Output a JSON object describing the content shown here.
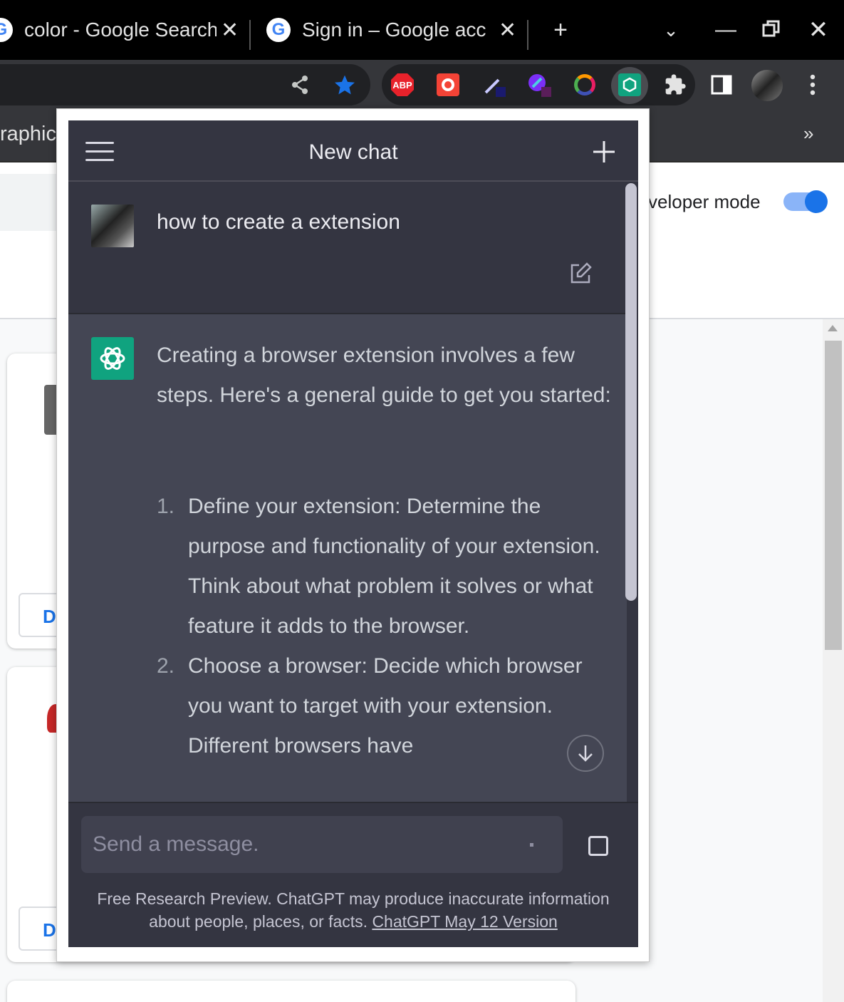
{
  "tabs": [
    {
      "title": "color - Google Search",
      "favicon": "google-icon"
    },
    {
      "title": "Sign in – Google accounts",
      "favicon": "google-icon"
    }
  ],
  "bookmarks": {
    "partial_text": "raphic",
    "overflow": "»"
  },
  "extensions": [
    "share-icon",
    "star-icon",
    "abp-icon",
    "red-circle-icon",
    "eyedropper-icon",
    "color-picker-icon",
    "color-wheel-icon",
    "chatgpt-icon",
    "puzzle-icon",
    "sidepanel-icon",
    "profile-avatar",
    "kebab-menu-icon"
  ],
  "abp_label": "ABP",
  "background_page": {
    "developer_mode_label": "veloper mode",
    "developer_mode_on": true,
    "card_button_partial": "De"
  },
  "chat": {
    "title": "New chat",
    "user_message": "how to create a extension",
    "assistant_intro": "Creating a browser extension involves a few steps. Here's a general guide to get you started:",
    "steps": [
      {
        "num": "1.",
        "text": "Define your extension: Determine the purpose and functionality of your extension. Think about what problem it solves or what feature it adds to the browser."
      },
      {
        "num": "2.",
        "text": "Choose a browser: Decide which browser you want to target with your extension. Different browsers have"
      }
    ],
    "input_placeholder": "Send a message.",
    "disclaimer": "Free Research Preview. ChatGPT may produce inaccurate information about people, places, or facts.",
    "version_link": "ChatGPT May 12 Version"
  },
  "colors": {
    "chat_bg": "#343541",
    "assistant_bg": "#444654",
    "gpt_green": "#10a37f",
    "toggle_blue": "#1a73e8"
  }
}
